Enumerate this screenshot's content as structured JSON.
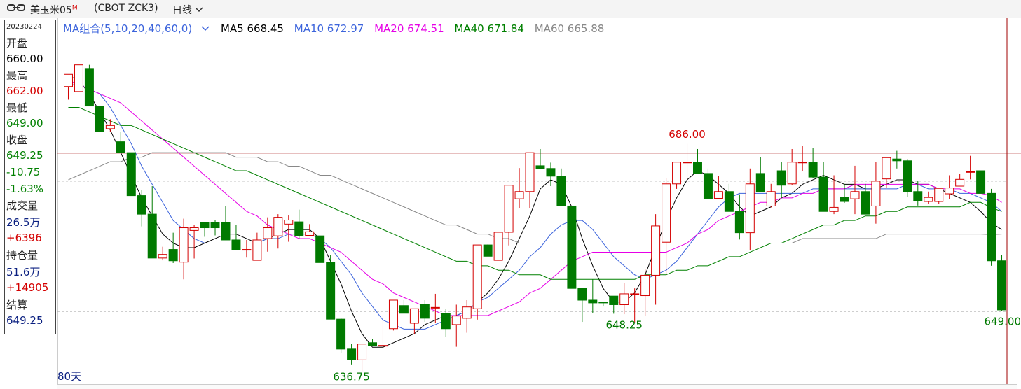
{
  "header": {
    "link_icon": "link-icon",
    "instrument": "美玉米05",
    "badge": "M",
    "code": "(CBOT ZCK3)",
    "period": "日线",
    "dropdown_icon": "chevron-down-icon"
  },
  "info": {
    "date": "20230224",
    "open_label": "开盘",
    "open": "660.00",
    "high_label": "最高",
    "high": "662.00",
    "low_label": "最低",
    "low": "649.00",
    "close_label": "收盘",
    "close": "649.25",
    "change": "-10.75",
    "change_pct": "-1.63%",
    "volume_label": "成交量",
    "volume": "26.5万",
    "volume_change": "+6396",
    "oi_label": "持仓量",
    "oi": "51.6万",
    "oi_change": "+14905",
    "settle_label": "结算",
    "settle": "649.25"
  },
  "ma_legend": {
    "group": "MA组合(5,10,20,40,60,0)",
    "ma5": "MA5 668.45",
    "ma10": "MA10 672.97",
    "ma20": "MA20 674.51",
    "ma40": "MA40 671.84",
    "ma60": "MA60 665.88"
  },
  "days_label": "80天",
  "colors": {
    "up": "#d40000",
    "down": "#007a00",
    "ma5": "#000000",
    "ma10": "#3c64dc",
    "ma20": "#e600e6",
    "ma40": "#008000",
    "ma60": "#888888",
    "crosshair": "#a00000"
  },
  "chart_data": {
    "type": "candlestick",
    "x_range_days": 80,
    "ylim": [
      633,
      710
    ],
    "annotations": [
      {
        "label": "686.00",
        "value": 686.0,
        "kind": "high"
      },
      {
        "label": "648.25",
        "value": 648.25,
        "kind": "low"
      },
      {
        "label": "636.75",
        "value": 636.75,
        "kind": "low"
      },
      {
        "label": "649.00",
        "value": 649.0,
        "kind": "low"
      }
    ],
    "crosshair_price": 683.9,
    "dashed_levels": [
      677.7,
      648.9
    ],
    "candles": [
      [
        698.6,
        701.3,
        695.7,
        701.3
      ],
      [
        697.5,
        703.4,
        697.5,
        703.4
      ],
      [
        702.6,
        703.4,
        694.3,
        694.3
      ],
      [
        694.3,
        694.3,
        688.6,
        688.6
      ],
      [
        689.3,
        691.4,
        688.6,
        690.0
      ],
      [
        686.4,
        688.6,
        684.0,
        684.0
      ],
      [
        684.0,
        684.0,
        674.5,
        674.5
      ],
      [
        674.5,
        675.7,
        667.7,
        670.4
      ],
      [
        670.4,
        676.6,
        660.7,
        660.7
      ],
      [
        660.7,
        663.2,
        660.2,
        661.5
      ],
      [
        662.6,
        666.3,
        659.6,
        660.1
      ],
      [
        659.8,
        669.4,
        656.0,
        667.4
      ],
      [
        666.8,
        668.1,
        660.6,
        667.4
      ],
      [
        668.5,
        668.5,
        665.4,
        667.4
      ],
      [
        668.5,
        669.1,
        665.7,
        667.4
      ],
      [
        668.5,
        672.2,
        664.7,
        664.7
      ],
      [
        664.7,
        668.1,
        662.6,
        662.6
      ],
      [
        662.6,
        664.7,
        660.8,
        662.6
      ],
      [
        660.2,
        666.3,
        660.2,
        664.7
      ],
      [
        665.0,
        669.7,
        662.1,
        667.4
      ],
      [
        665.6,
        670.4,
        662.8,
        669.7
      ],
      [
        668.2,
        670.1,
        664.3,
        669.1
      ],
      [
        668.7,
        671.4,
        664.9,
        665.7
      ],
      [
        665.7,
        668.2,
        666.5,
        666.5
      ],
      [
        665.6,
        665.6,
        659.7,
        659.7
      ],
      [
        659.7,
        661.4,
        647.2,
        647.2
      ],
      [
        647.2,
        647.4,
        639.8,
        640.6
      ],
      [
        640.6,
        641.7,
        637.2,
        638.2
      ],
      [
        638.2,
        641.7,
        635.7,
        641.7
      ],
      [
        642.0,
        642.8,
        641.4,
        641.4
      ],
      [
        641.3,
        648.2,
        641.2,
        641.4
      ],
      [
        645.1,
        651.4,
        644.7,
        651.4
      ],
      [
        650.2,
        651.4,
        648.5,
        648.5
      ],
      [
        646.3,
        649.5,
        643.9,
        649.5
      ],
      [
        650.4,
        651.4,
        646.6,
        647.4
      ],
      [
        649.8,
        652.8,
        646.3,
        649.8
      ],
      [
        648.5,
        649.4,
        643.3,
        645.1
      ],
      [
        646.0,
        650.4,
        641.1,
        647.9
      ],
      [
        647.4,
        651.4,
        644.2,
        649.9
      ],
      [
        649.5,
        663.6,
        647.1,
        663.6
      ],
      [
        663.6,
        663.7,
        661.1,
        661.1
      ],
      [
        660.2,
        666.4,
        663.6,
        666.4
      ],
      [
        666.4,
        676.8,
        663.5,
        676.8
      ],
      [
        673.8,
        680.6,
        671.7,
        675.4
      ],
      [
        675.4,
        684.0,
        671.7,
        684.0
      ],
      [
        681.1,
        684.8,
        680.5,
        680.5
      ],
      [
        680.5,
        681.8,
        676.6,
        678.8
      ],
      [
        678.8,
        680.5,
        672.2,
        672.2
      ],
      [
        672.2,
        672.2,
        654.0,
        654.0
      ],
      [
        654.0,
        654.0,
        646.6,
        651.4
      ],
      [
        651.4,
        656.0,
        648.5,
        650.8
      ],
      [
        651.0,
        650.8,
        650.0,
        650.8
      ],
      [
        652.3,
        650.8,
        648.4,
        650.4
      ],
      [
        650.4,
        655.2,
        648.3,
        652.8
      ],
      [
        652.8,
        654.0,
        646.5,
        652.8
      ],
      [
        652.4,
        658.2,
        648.0,
        656.9
      ],
      [
        656.9,
        670.4,
        650.4,
        667.8
      ],
      [
        664.2,
        678.3,
        656.9,
        677.1
      ],
      [
        677.1,
        681.9,
        676.0,
        681.9
      ],
      [
        681.9,
        686.0,
        677.1,
        681.9
      ],
      [
        681.9,
        684.8,
        679.4,
        679.4
      ],
      [
        679.4,
        680.5,
        673.9,
        673.9
      ],
      [
        673.9,
        678.8,
        673.9,
        675.4
      ],
      [
        675.4,
        677.1,
        671.0,
        671.0
      ],
      [
        671.0,
        674.8,
        664.8,
        666.3
      ],
      [
        666.3,
        680.5,
        662.5,
        677.1
      ],
      [
        679.4,
        683.0,
        675.4,
        675.4
      ],
      [
        672.2,
        677.1,
        671.9,
        675.4
      ],
      [
        680.0,
        681.9,
        673.9,
        676.8
      ],
      [
        677.1,
        684.8,
        676.9,
        681.9
      ],
      [
        681.9,
        685.5,
        680.0,
        681.9
      ],
      [
        681.9,
        685.0,
        678.3,
        678.6
      ],
      [
        678.6,
        681.9,
        671.0,
        671.0
      ],
      [
        671.0,
        679.0,
        670.4,
        671.9
      ],
      [
        674.1,
        677.1,
        672.9,
        673.2
      ],
      [
        673.8,
        681.1,
        670.4,
        675.4
      ],
      [
        675.4,
        677.1,
        670.4,
        670.4
      ],
      [
        672.2,
        682.0,
        668.3,
        677.7
      ],
      [
        678.2,
        682.9,
        676.3,
        682.9
      ],
      [
        682.6,
        684.4,
        680.5,
        682.2
      ],
      [
        682.2,
        682.6,
        674.2,
        675.4
      ],
      [
        675.4,
        677.7,
        672.3,
        673.3
      ],
      [
        673.2,
        675.4,
        672.6,
        674.1
      ],
      [
        673.2,
        675.4,
        672.6,
        676.1
      ],
      [
        674.9,
        679.0,
        673.8,
        676.2
      ],
      [
        676.6,
        679.3,
        676.6,
        678.1
      ],
      [
        679.7,
        683.3,
        678.1,
        679.8
      ],
      [
        680.0,
        680.0,
        675.0,
        675.0
      ],
      [
        675.0,
        676.0,
        659.0,
        660.1
      ],
      [
        660.1,
        661.4,
        649.0,
        649.25
      ]
    ],
    "ma_series": {
      "MA5": [
        701,
        700,
        697,
        693,
        689,
        684,
        679,
        674,
        670,
        666,
        664,
        663,
        663,
        664,
        665,
        666,
        666,
        665,
        664,
        665,
        666,
        667,
        667,
        667,
        665,
        660,
        655,
        649,
        644,
        641,
        641,
        642,
        643,
        644,
        646,
        647,
        648,
        648,
        649,
        651,
        653,
        656,
        660,
        665,
        670,
        676,
        678,
        677,
        672,
        665,
        659,
        654,
        651,
        651,
        653,
        657,
        663,
        669,
        674,
        678,
        680,
        679,
        677,
        675,
        672,
        670,
        671,
        672,
        674,
        675,
        677,
        678,
        679,
        678,
        677,
        677,
        676,
        676,
        677,
        678,
        678,
        677,
        677,
        676,
        675,
        674,
        673,
        671,
        668.45,
        667
      ],
      "MA10": [
        699,
        699,
        698,
        697,
        694,
        690,
        686,
        681,
        677,
        673,
        669,
        667,
        665,
        664,
        664,
        664,
        664,
        664,
        664,
        665,
        665,
        666,
        666,
        666,
        665,
        663,
        660,
        657,
        653,
        650,
        647,
        646,
        645,
        645,
        645,
        646,
        647,
        648,
        649,
        651,
        652,
        654,
        656,
        658,
        661,
        663,
        666,
        668,
        669,
        669,
        667,
        664,
        661,
        659,
        657,
        656,
        657,
        658,
        660,
        663,
        666,
        669,
        672,
        674,
        675,
        675,
        675,
        675,
        675,
        675,
        675,
        676,
        676,
        676,
        676,
        676,
        676,
        676,
        676,
        676,
        677,
        677,
        676,
        676,
        676,
        675,
        675,
        674,
        672.97,
        671
      ],
      "MA20": [
        700,
        699,
        698,
        697,
        696,
        695,
        693,
        691,
        689,
        687,
        685,
        683,
        681,
        679,
        677,
        675,
        673,
        671,
        670,
        668,
        667,
        666,
        665,
        665,
        664,
        663,
        662,
        660,
        658,
        656,
        655,
        653,
        652,
        651,
        650,
        649,
        648,
        648,
        648,
        648,
        648,
        649,
        650,
        651,
        653,
        654,
        656,
        658,
        660,
        661,
        662,
        662,
        662,
        662,
        662,
        662,
        662,
        662,
        663,
        664,
        666,
        667,
        669,
        670,
        671,
        672,
        673,
        673,
        674,
        674,
        675,
        675,
        676,
        676,
        676,
        677,
        677,
        677,
        677,
        677,
        677,
        677,
        677,
        676,
        676,
        676,
        675,
        675,
        674.51,
        673
      ],
      "MA40": [
        694,
        694,
        693,
        692,
        691,
        690,
        690,
        689,
        688,
        687,
        686,
        685,
        684,
        683,
        682,
        681,
        680,
        680,
        679,
        678,
        677,
        676,
        675,
        674,
        673,
        672,
        671,
        670,
        669,
        668,
        667,
        666,
        665,
        664,
        663,
        662,
        661,
        660,
        660,
        659,
        659,
        658,
        658,
        657,
        657,
        657,
        656,
        656,
        656,
        656,
        656,
        656,
        656,
        656,
        656,
        657,
        657,
        657,
        658,
        658,
        659,
        659,
        660,
        661,
        661,
        662,
        663,
        664,
        664,
        665,
        666,
        667,
        668,
        668,
        669,
        669,
        670,
        670,
        671,
        671,
        672,
        672,
        672,
        672,
        672,
        672,
        673,
        673,
        671.84,
        671
      ],
      "MA60": [
        678,
        679,
        680,
        681,
        682,
        682,
        683,
        683,
        684,
        684,
        684,
        684,
        684,
        684,
        684,
        684,
        683,
        683,
        683,
        682,
        682,
        681,
        681,
        680,
        679,
        679,
        678,
        677,
        676,
        675,
        674,
        673,
        672,
        671,
        670,
        669,
        668,
        668,
        667,
        666,
        666,
        665,
        665,
        664,
        664,
        664,
        664,
        664,
        664,
        664,
        664,
        664,
        664,
        664,
        664,
        664,
        664,
        664,
        664,
        664,
        664,
        664,
        664,
        664,
        664,
        664,
        664,
        664,
        664,
        664,
        665,
        665,
        665,
        665,
        665,
        665,
        665,
        665,
        666,
        666,
        666,
        666,
        666,
        666,
        666,
        666,
        666,
        666,
        665.88,
        666
      ]
    }
  }
}
